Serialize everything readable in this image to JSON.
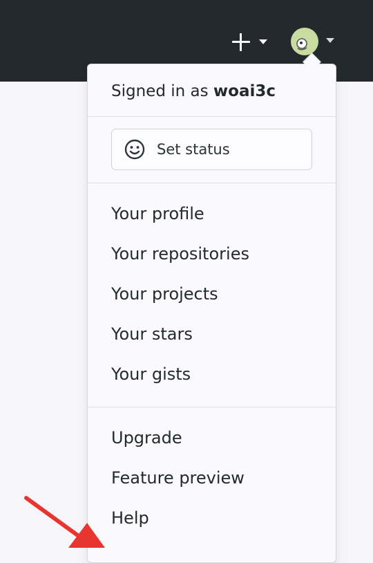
{
  "header": {
    "new_icon": "plus-icon",
    "avatar_icon": "avatar"
  },
  "dropdown": {
    "signed_in_prefix": "Signed in as ",
    "username": "woai3c",
    "set_status": {
      "icon": "smiley-icon",
      "label": "Set status"
    },
    "profile_links": [
      "Your profile",
      "Your repositories",
      "Your projects",
      "Your stars",
      "Your gists"
    ],
    "misc_links": [
      "Upgrade",
      "Feature preview",
      "Help"
    ]
  },
  "colors": {
    "header_bg": "#24292e",
    "page_bg": "#f6f5fa",
    "annotation_arrow": "#e8352f"
  }
}
